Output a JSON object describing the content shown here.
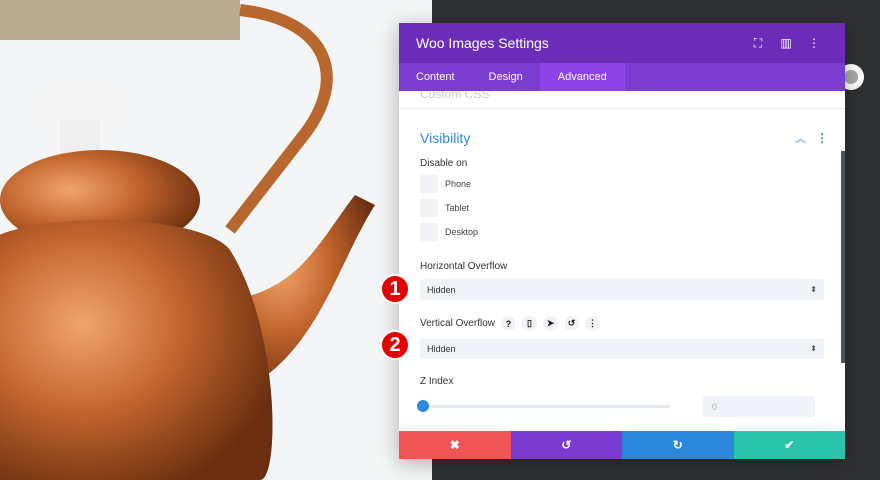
{
  "modal": {
    "title": "Woo Images Settings",
    "tabs": [
      "Content",
      "Design",
      "Advanced"
    ],
    "ghost_section": "Custom CSS",
    "section": "Visibility",
    "disable_on": {
      "label": "Disable on",
      "options": [
        "Phone",
        "Tablet",
        "Desktop"
      ]
    },
    "horizontal_overflow": {
      "label": "Horizontal Overflow",
      "value": "Hidden"
    },
    "vertical_overflow": {
      "label": "Vertical Overflow",
      "value": "Hidden"
    },
    "z_index": {
      "label": "Z Index",
      "value": "0",
      "slider_fraction": 0
    }
  },
  "badges": [
    "1",
    "2"
  ],
  "colors": {
    "header": "#6c2eb9",
    "tabs": "#7b3dd0",
    "accent": "#2e8ae0",
    "cancel": "#ef5555",
    "undo": "#7b3bd0",
    "redo": "#2b87da",
    "save": "#29c4a9"
  }
}
